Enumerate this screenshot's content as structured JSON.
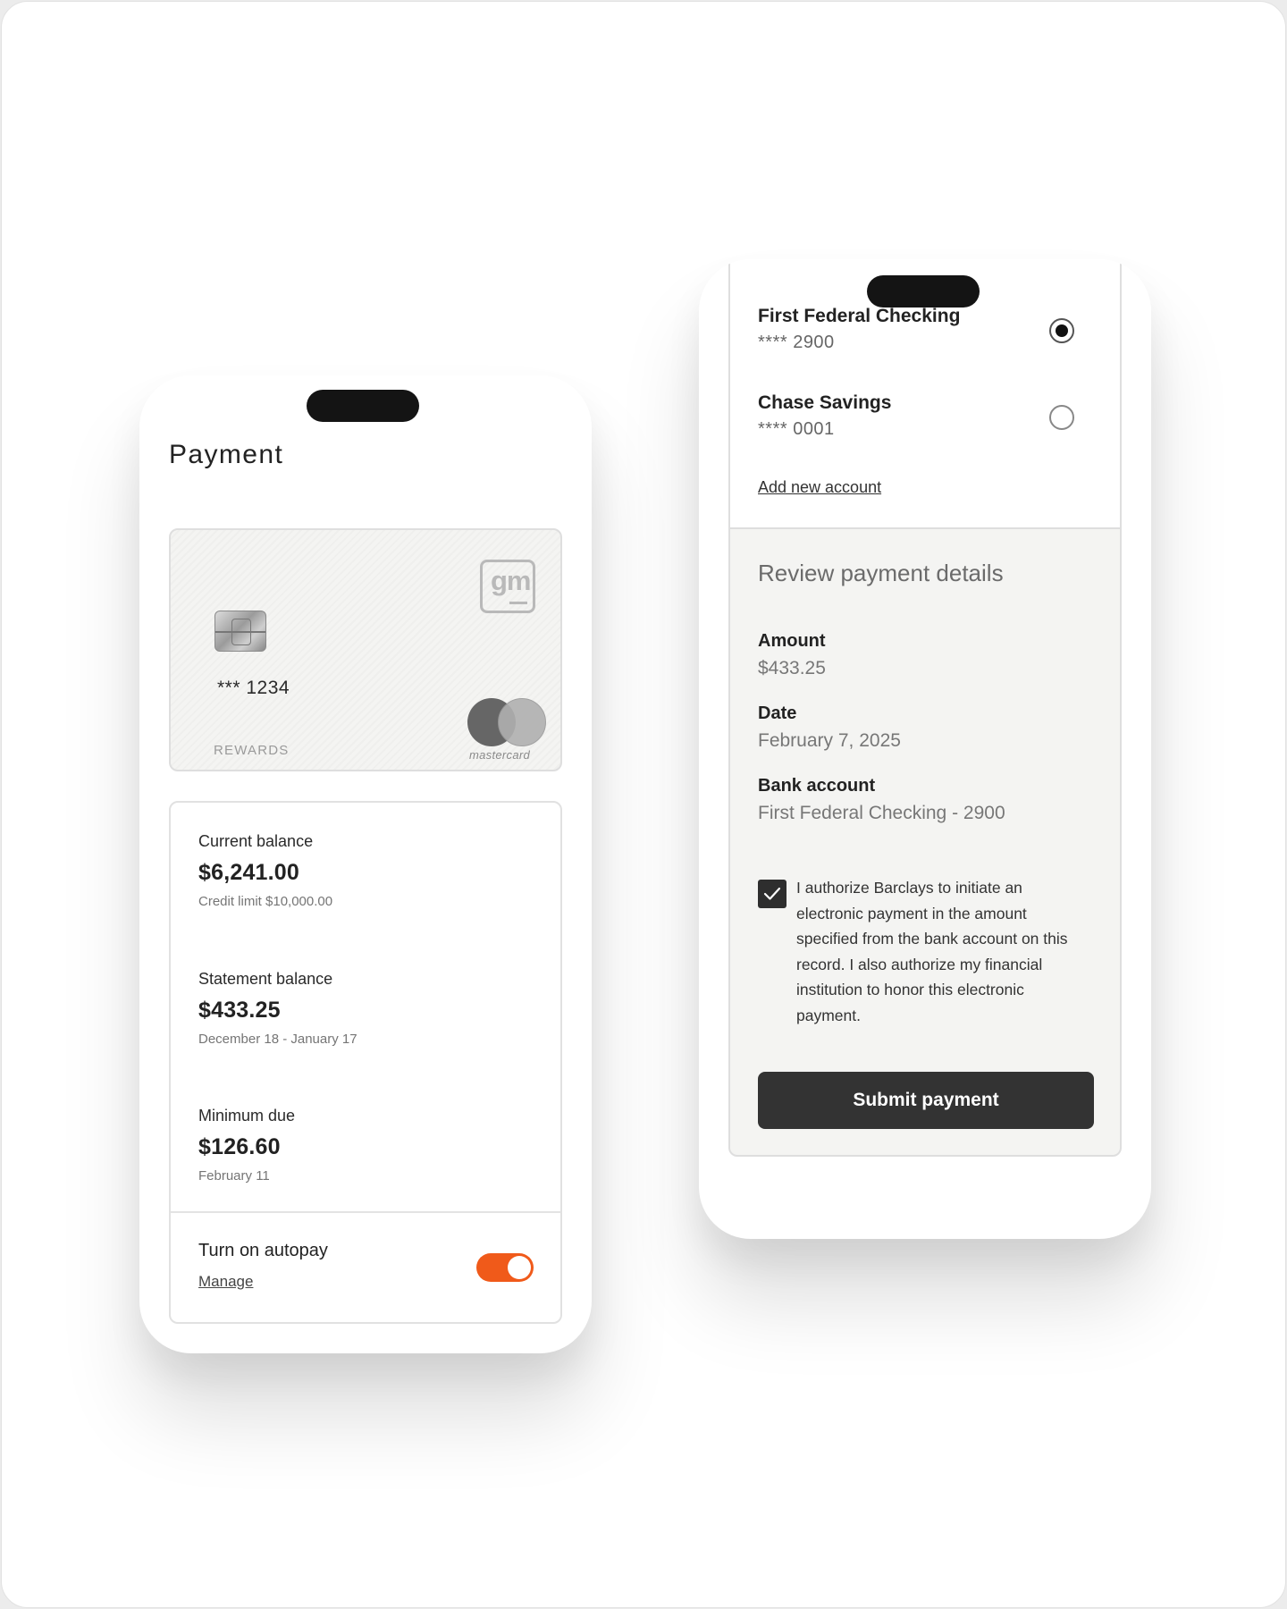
{
  "left_screen": {
    "title": "Payment",
    "card": {
      "brand_logo_icon": "gm-logo-icon",
      "brand_logo_text": "gm",
      "number": "*** 1234",
      "tier": "REWARDS",
      "network": "mastercard"
    },
    "balances": [
      {
        "label": "Current balance",
        "value": "$6,241.00",
        "sub": "Credit limit $10,000.00"
      },
      {
        "label": "Statement balance",
        "value": "$433.25",
        "sub": "December 18 - January 17"
      },
      {
        "label": "Minimum due",
        "value": "$126.60",
        "sub": "February 11"
      }
    ],
    "autopay": {
      "label": "Turn on autopay",
      "manage": "Manage",
      "enabled": true,
      "toggle_color": "#f05a1a"
    }
  },
  "right_screen": {
    "accounts": [
      {
        "name": "First Federal Checking",
        "number": "**** 2900",
        "selected": true
      },
      {
        "name": "Chase Savings",
        "number": "**** 0001",
        "selected": false
      }
    ],
    "add_account": "Add new account",
    "review": {
      "title": "Review payment details",
      "details": [
        {
          "label": "Amount",
          "value": "$433.25"
        },
        {
          "label": "Date",
          "value": "February 7, 2025"
        },
        {
          "label": "Bank account",
          "value": "First Federal Checking - 2900"
        }
      ],
      "authorization_checked": true,
      "authorization_text": "I authorize Barclays to initiate an electronic payment in the amount specified from the bank account on this record. I also authorize my financial institution to honor this electronic payment.",
      "submit_label": "Submit payment"
    }
  },
  "colors": {
    "accent": "#f05a1a",
    "button": "#333333",
    "panel": "#f4f4f2"
  }
}
